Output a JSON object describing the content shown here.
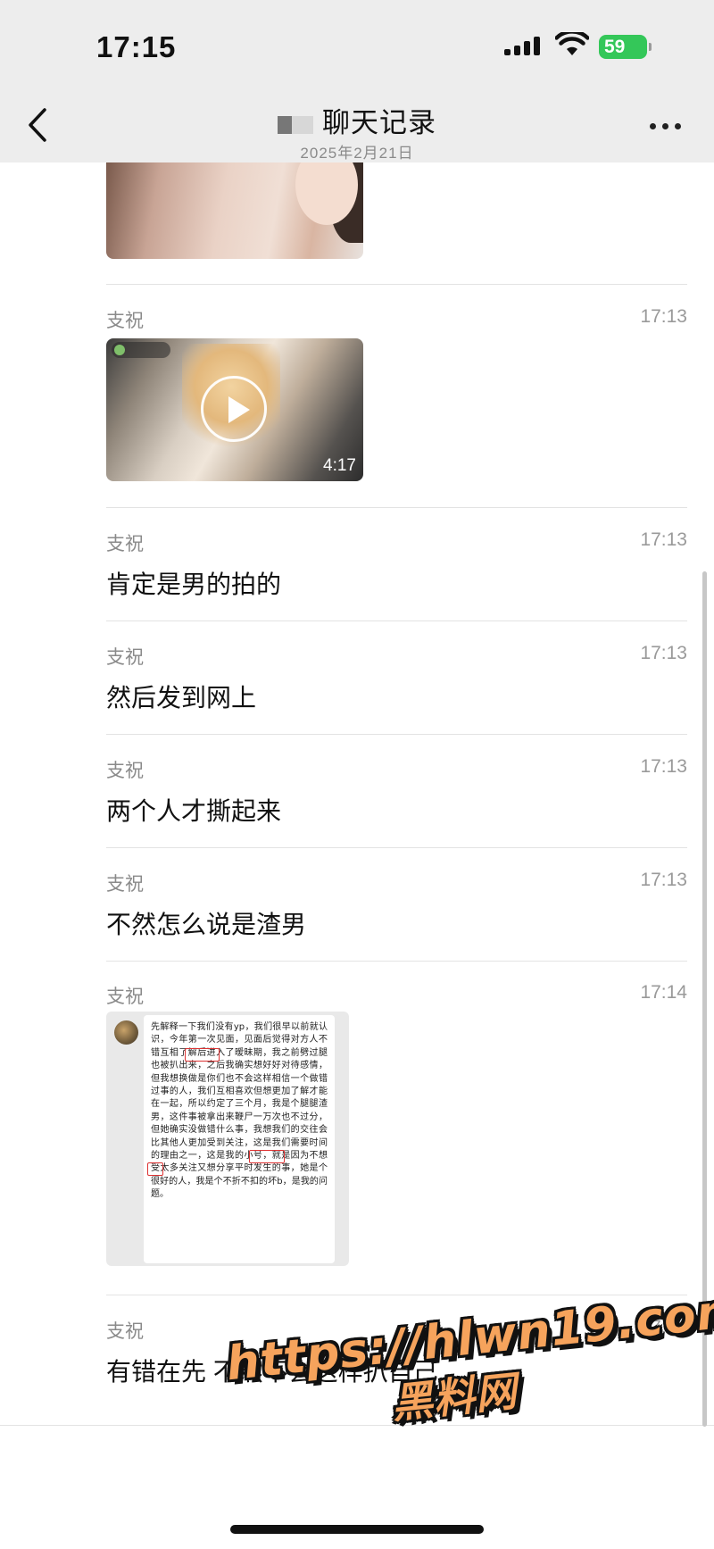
{
  "status_bar": {
    "time": "17:15",
    "battery": "59"
  },
  "header": {
    "title": "聊天记录",
    "date": "2025年2月21日"
  },
  "messages": [
    {
      "sender": "支祝",
      "time": "17:13",
      "type": "video",
      "duration": "4:17"
    },
    {
      "sender": "支祝",
      "time": "17:13",
      "type": "text",
      "text": "肯定是男的拍的"
    },
    {
      "sender": "支祝",
      "time": "17:13",
      "type": "text",
      "text": "然后发到网上"
    },
    {
      "sender": "支祝",
      "time": "17:13",
      "type": "text",
      "text": "两个人才撕起来"
    },
    {
      "sender": "支祝",
      "time": "17:13",
      "type": "text",
      "text": "不然怎么说是渣男"
    },
    {
      "sender": "支祝",
      "time": "17:14",
      "type": "image"
    },
    {
      "sender": "支祝",
      "time": "17:14",
      "type": "text",
      "text": "有错在先 不然不会这样扒自己"
    }
  ],
  "screenshot_text": "先解释一下我们没有yp，我们很早以前就认识，今年第一次见面，见面后觉得对方人不错互相了解后进入了暧昧期，我之前劈过腿也被扒出来，之后我确实想好好对待感情，但我想换做是你们也不会这样相信一个做错过事的人，我们互相喜欢但想更加了解才能在一起，所以约定了三个月，我是个腿腿渣男，这件事被拿出来鞭尸一万次也不过分，但她确实没做错什么事，我想我们的交往会比其他人更加受到关注，这是我们需要时间的理由之一，这是我的小号，就是因为不想受太多关注又想分享平时发生的事，她是个很好的人，我是个不折不扣的坏b，是我的问题。",
  "watermark": {
    "url": "https://hlwn19.com",
    "name": "黑料网"
  },
  "colors": {
    "header_bg": "#ededed",
    "battery": "#34c759",
    "overlay_fill": "#f6a35c"
  },
  "icons": [
    "back-chevron-icon",
    "more-dots-icon",
    "cellular-signal-icon",
    "wifi-icon",
    "battery-icon",
    "play-icon"
  ]
}
